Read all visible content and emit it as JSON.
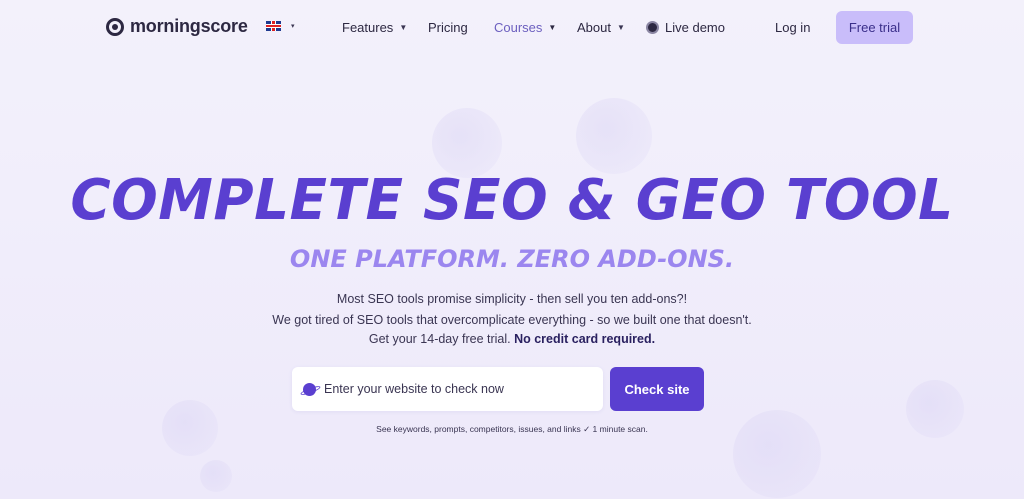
{
  "brand": {
    "name": "morningscore"
  },
  "language": {
    "flag": "uk-flag-icon",
    "caret": "▾"
  },
  "nav": {
    "features": "Features",
    "pricing": "Pricing",
    "courses": "Courses",
    "about": "About",
    "live_demo": "Live demo",
    "login": "Log in",
    "free_trial": "Free trial"
  },
  "hero": {
    "title": "COMPLETE SEO & GEO TOOL",
    "subtitle": "ONE PLATFORM. ZERO ADD-ONS.",
    "line1": "Most SEO tools promise simplicity - then sell you ten add-ons?!",
    "line2": "We got tired of SEO tools that overcomplicate everything - so we built one that doesn't.",
    "line3_prefix": "Get your 14-day free trial.",
    "line3_bold": "No credit card required."
  },
  "search": {
    "placeholder": "Enter your website to check now",
    "button": "Check site"
  },
  "footnote": "See keywords, prompts, competitors, issues, and links ✓ 1 minute scan.",
  "colors": {
    "accent": "#5a3fd0",
    "accent_light": "#9b86ef",
    "button_light": "#c9bdfa"
  }
}
